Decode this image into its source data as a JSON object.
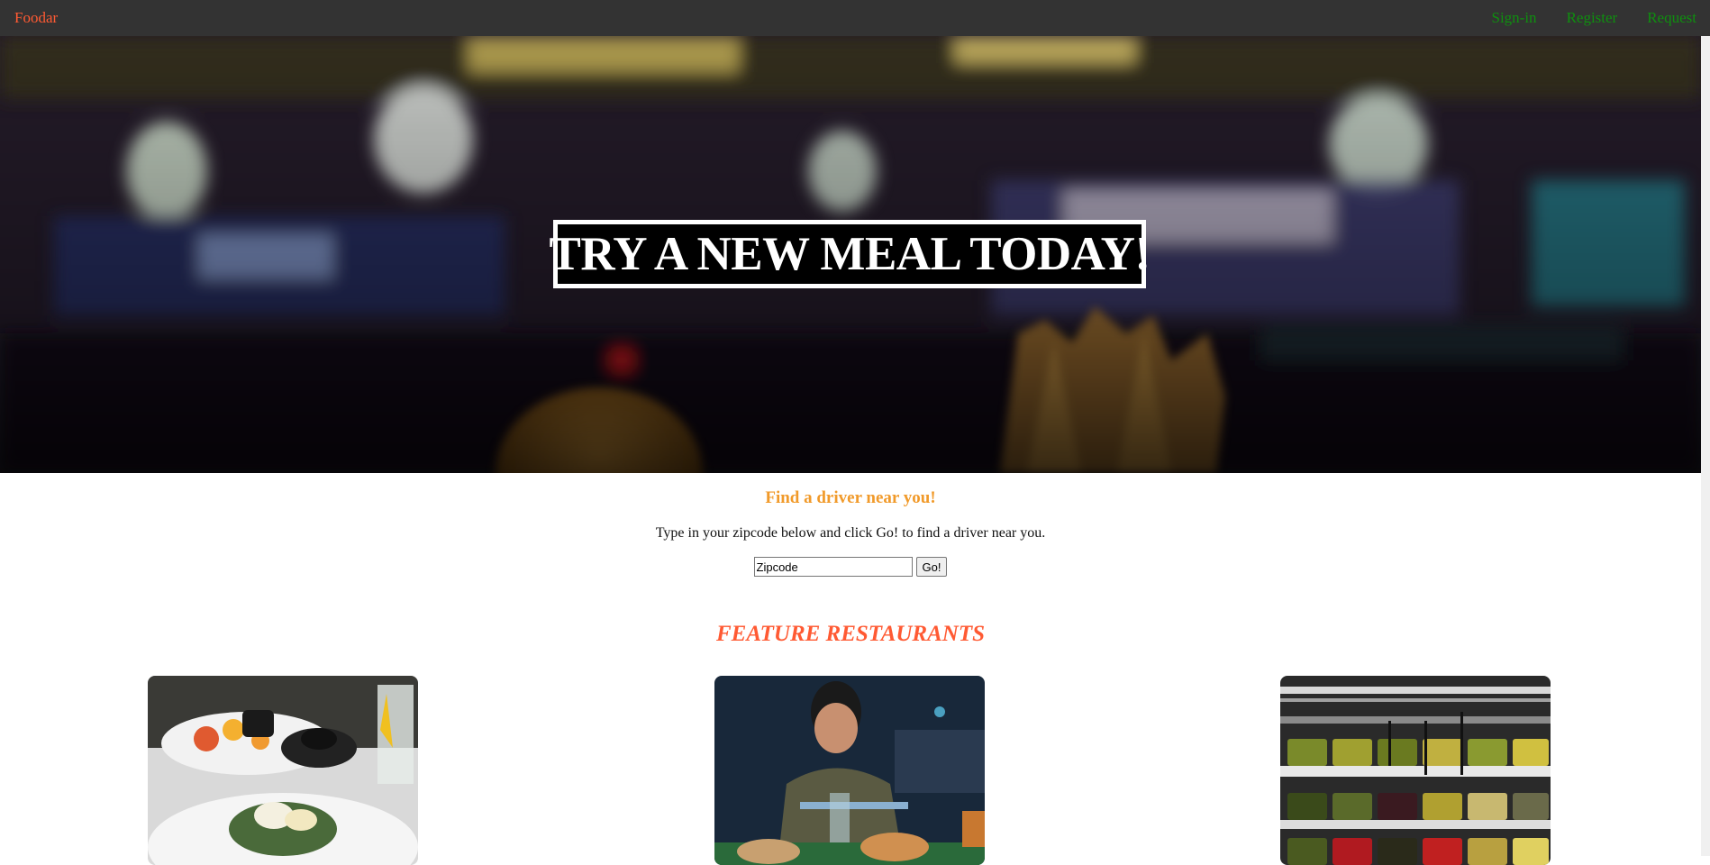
{
  "nav": {
    "brand": "Foodar",
    "links": [
      "Sign-in",
      "Register",
      "Request"
    ]
  },
  "hero": {
    "title": "TRY A NEW MEAL TODAY!"
  },
  "finder": {
    "title": "Find a driver near you!",
    "description": "Type in your zipcode below and click Go! to find a driver near you.",
    "zip_value": "Zipcode",
    "go_label": "Go!"
  },
  "features": {
    "title": "FEATURE RESTAURANTS"
  },
  "colors": {
    "nav_bg": "#333333",
    "brand": "#ff5a33",
    "nav_link": "#0f8f0f",
    "finder_title": "#f19a2a",
    "feature_title": "#ff5a33"
  }
}
